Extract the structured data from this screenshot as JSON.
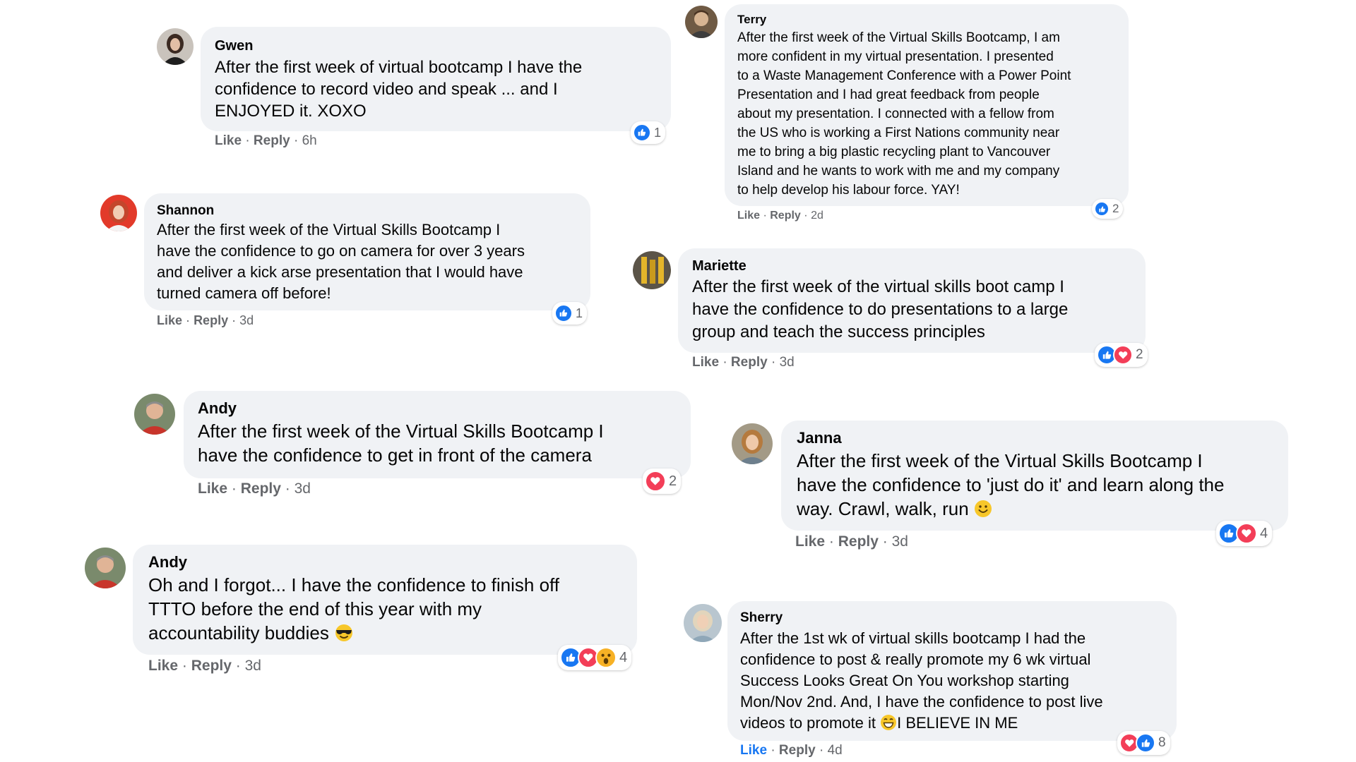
{
  "colors": {
    "like_blue": "#1877f2",
    "love_red": "#f33e58",
    "wow_yellow": "#f7b125",
    "bubble_gray": "#f0f2f5",
    "meta_gray": "#65676b"
  },
  "actions": {
    "like": "Like",
    "reply": "Reply",
    "sep": "·"
  },
  "comments": [
    {
      "name": "Gwen",
      "lines": [
        "After the first week of virtual bootcamp I have the",
        "confidence to record video and speak ... and I",
        "ENJOYED it. XOXO"
      ],
      "time": "6h",
      "reactions": [
        "like"
      ],
      "count": "1"
    },
    {
      "name": "Terry",
      "lines": [
        "After the first week of the Virtual Skills Bootcamp, I am",
        "more confident in my virtual presentation. I presented",
        "to a Waste Management Conference with a Power Point",
        "Presentation and I had great feedback from people",
        "about my presentation. I connected with a fellow from",
        "the US who is working a First Nations community near",
        "me to bring a big plastic recycling plant to Vancouver",
        "Island and he wants to work with me and my company",
        "to help develop his labour force. YAY!"
      ],
      "time": "2d",
      "reactions": [
        "like"
      ],
      "count": "2"
    },
    {
      "name": "Shannon",
      "lines": [
        "After the first week of the Virtual Skills Bootcamp I",
        "have the confidence to go on camera for over 3 years",
        "and deliver a kick arse presentation that I would have",
        "turned camera off before!"
      ],
      "time": "3d",
      "reactions": [
        "like"
      ],
      "count": "1"
    },
    {
      "name": "Mariette",
      "lines": [
        "After the first week of the virtual skills boot camp I",
        "have the confidence to do presentations to a large",
        "group and teach the success principles"
      ],
      "time": "3d",
      "reactions": [
        "like",
        "love"
      ],
      "count": "2"
    },
    {
      "name": "Andy",
      "lines": [
        "After the first week of the Virtual Skills Bootcamp I",
        "have the confidence to get in front of the camera"
      ],
      "time": "3d",
      "reactions": [
        "love"
      ],
      "count": "2"
    },
    {
      "name": "Janna",
      "lines": [
        "After the first week of the Virtual Skills Bootcamp I",
        "have the confidence to 'just do it' and learn along the",
        "way. Crawl, walk, run"
      ],
      "time": "3d",
      "reactions": [
        "like",
        "love"
      ],
      "count": "4",
      "emoji": "smile"
    },
    {
      "name": "Andy",
      "lines": [
        "Oh and I forgot... I have the confidence to finish off",
        "TTTO before the end of this year with my",
        "accountability buddies"
      ],
      "time": "3d",
      "reactions": [
        "like",
        "love",
        "wow"
      ],
      "count": "4",
      "emoji": "sunglasses"
    },
    {
      "name": "Sherry",
      "lines": [
        "After the 1st wk of virtual skills bootcamp I had the",
        "confidence to post & really promote my 6 wk virtual",
        "Success Looks Great On You workshop starting",
        "Mon/Nov 2nd. And, I have the confidence to post live",
        "videos to promote it",
        "I BELIEVE IN ME"
      ],
      "time": "4d",
      "reactions": [
        "love",
        "like"
      ],
      "count": "8",
      "emoji": "grin",
      "liked": true
    }
  ]
}
